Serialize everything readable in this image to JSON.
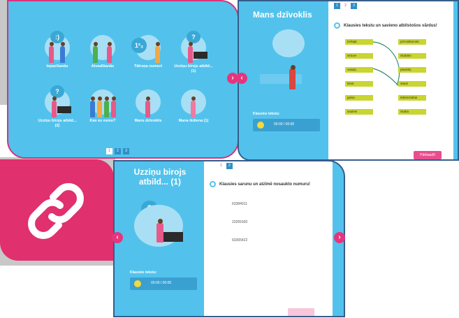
{
  "menu": {
    "tiles": [
      {
        "caption": "Iepazīšanās",
        "bubble": ":)"
      },
      {
        "caption": "Atvadīšanās",
        "bubble": ""
      },
      {
        "caption": "Tālruņa numuri",
        "bubble": "1²₃"
      },
      {
        "caption": "Uzziņu birojs atbild... (1)",
        "bubble": "?"
      },
      {
        "caption": "Uzziņu birojs atbild... (2)",
        "bubble": "?"
      },
      {
        "caption": "Kas es esmu?",
        "bubble": ""
      },
      {
        "caption": "Mans dzīvoklis",
        "bubble": ""
      },
      {
        "caption": "Mana ikdiena (1)",
        "bubble": ""
      }
    ],
    "pages": [
      "1",
      "2",
      "3"
    ]
  },
  "exercise1": {
    "title": "Mans dzīvoklis",
    "instruction": "Klausies tekstu un savieno atbilstošos vārdus!",
    "pages": [
      "1",
      "2",
      "3"
    ],
    "left_words": [
      "trešajā",
      "virtuve",
      "vasaļu",
      "lietot",
      "gaisa",
      "sauleni"
    ],
    "right_words": [
      "pirmsākumās",
      "istabām",
      "plauktiņ",
      "stāvā",
      "ēdamistabai",
      "istaba"
    ],
    "audio_label": "Klausies tekstu:",
    "time": "00:00 / 00:00",
    "check_label": "Pārbaudīt"
  },
  "exercise2": {
    "title": "Uzziņu birojs atbild... (1)",
    "instruction": "Klausies sarunu un atzīmē nosaukto numuru!",
    "pages": [
      "1",
      "2"
    ],
    "numbers": [
      "63384011",
      "23281600",
      "63365422"
    ],
    "audio_label": "Klausies tekstu:",
    "time": "00:00 / 00:00"
  },
  "nav": {
    "prev": "‹",
    "next": "›"
  },
  "colors": {
    "panel": "#52c2ec",
    "accent": "#e0306e",
    "border_pink": "#d8337a",
    "border_navy": "#355d8a",
    "word_bg": "#c9d530"
  }
}
